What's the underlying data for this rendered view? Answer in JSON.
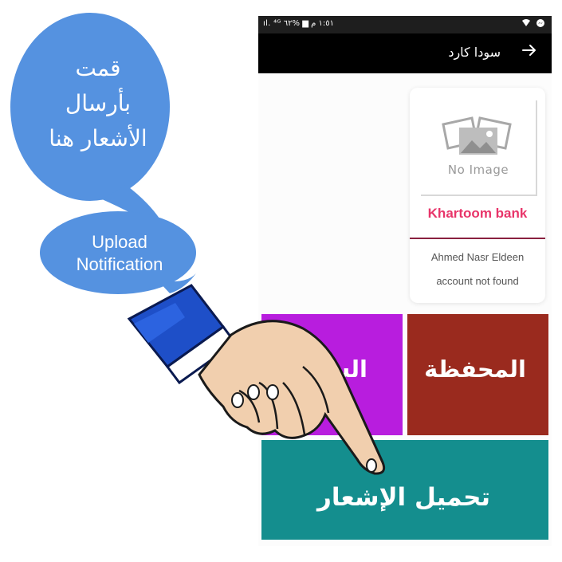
{
  "statusbar": {
    "left_text": "١:٥١ م ▆ %٦٢ ıl. ⁴ᴳ",
    "icons": [
      "wifi-icon",
      "messenger-icon"
    ]
  },
  "appbar": {
    "title": "سودا كارد",
    "back_icon": "arrow-right-icon"
  },
  "card": {
    "image_placeholder": "No Image",
    "bank_name": "Khartoom bank",
    "owner_name": "Ahmed Nasr Eldeen",
    "account_status": "account not found"
  },
  "tiles": {
    "wallet": "المحفظة",
    "purple_partial": "السـ",
    "upload_notification": "تحميل الإشعار"
  },
  "annotations": {
    "arabic_bubble": "قمت بأرسال الأشعار هنا",
    "english_bubble": "Upload Notification"
  },
  "colors": {
    "bubble": "#5592e0",
    "wallet_tile": "#9a2a1e",
    "purple_tile": "#b81dde",
    "teal_tile": "#148e8e",
    "bank_name": "#e8356a",
    "appbar": "#000000"
  }
}
